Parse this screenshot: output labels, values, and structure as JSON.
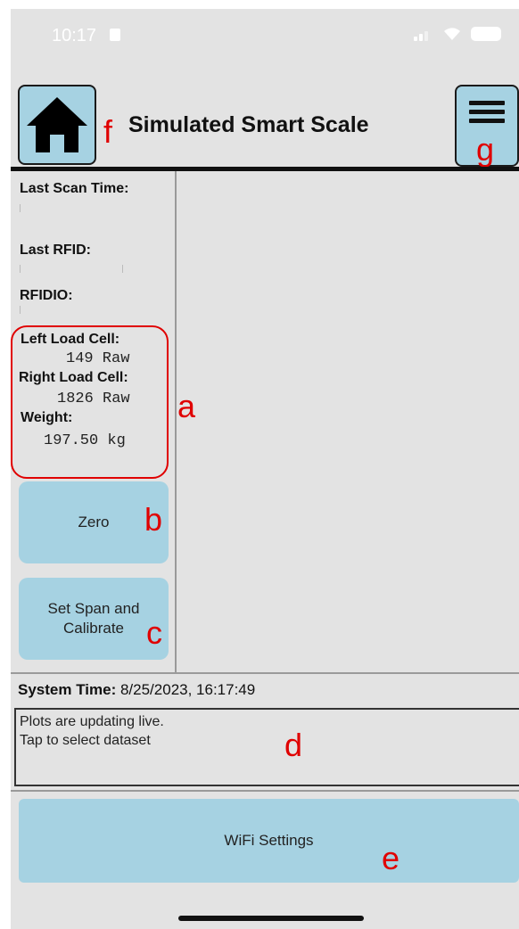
{
  "status_bar": {
    "time": "10:17"
  },
  "header": {
    "title": "Simulated Smart Scale",
    "home_icon": "home-icon",
    "menu_icon": "hamburger-menu-icon"
  },
  "side_panel": {
    "last_scan_time_label": "Last Scan Time:",
    "last_rfid_label": "Last RFID:",
    "rfidio_label": "RFIDIO:",
    "left_load_cell_label": "Left Load Cell:",
    "left_load_cell_value": "149 Raw",
    "right_load_cell_label": "Right Load Cell:",
    "right_load_cell_value": "1826 Raw",
    "weight_label": "Weight:",
    "weight_value": "197.50 kg",
    "zero_button": "Zero",
    "span_button_line1": "Set Span and",
    "span_button_line2": "Calibrate"
  },
  "system_time": {
    "label": "System Time:",
    "value": "8/25/2023, 16:17:49"
  },
  "message": {
    "line1": "Plots are updating live.",
    "line2": "Tap to select dataset"
  },
  "wifi_button": "WiFi Settings",
  "annotations": {
    "a": "a",
    "b": "b",
    "c": "c",
    "d": "d",
    "e": "e",
    "f": "f",
    "g": "g"
  },
  "colors": {
    "button_blue": "#a6d2e2",
    "annotation_red": "#e00000",
    "background": "#e3e3e3"
  }
}
